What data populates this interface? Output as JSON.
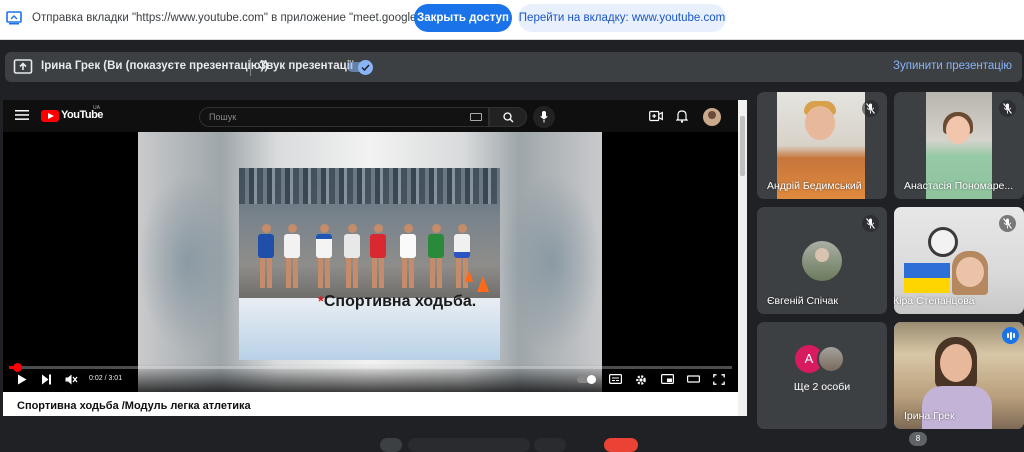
{
  "banner": {
    "message": "Отправка вкладки \"https://www.youtube.com\" в приложение \"meet.google.com\"...",
    "close_access_label": "Закрыть доступ",
    "goto_tab_label": "Перейти на вкладку: www.youtube.com"
  },
  "presentation_bar": {
    "presenter": "Ірина Грек (Ви (показуєте презентацію))",
    "audio_label": "Звук презентації",
    "audio_enabled": true,
    "stop_label": "Зупинити презентацію"
  },
  "youtube": {
    "logo_text": "YouTube",
    "region": "UA",
    "search_placeholder": "Пошук",
    "slide_caption": "Спортивна ходьба.",
    "slide_star": "*",
    "time": "0:02 / 3:01",
    "progress": 0.011,
    "video_title": "Спортивна ходьба /Модуль легка атлетика"
  },
  "participants": [
    {
      "name": "Андрій Бедимський",
      "muted": true
    },
    {
      "name": "Анастасія Пономаре...",
      "muted": true
    },
    {
      "name": "Євгеній Спічак",
      "muted": true
    },
    {
      "name": "Кіра Степанцова",
      "muted": true
    },
    {
      "name": "Ще 2 особи",
      "avatar_letter": "А"
    },
    {
      "name": "Ірина Грек",
      "speaking": true
    }
  ],
  "participant_count": "8",
  "colors": {
    "accent": "#1a73e8",
    "meet_bg": "#202124",
    "tile_bg": "#3c4043",
    "youtube_red": "#ff0000"
  }
}
